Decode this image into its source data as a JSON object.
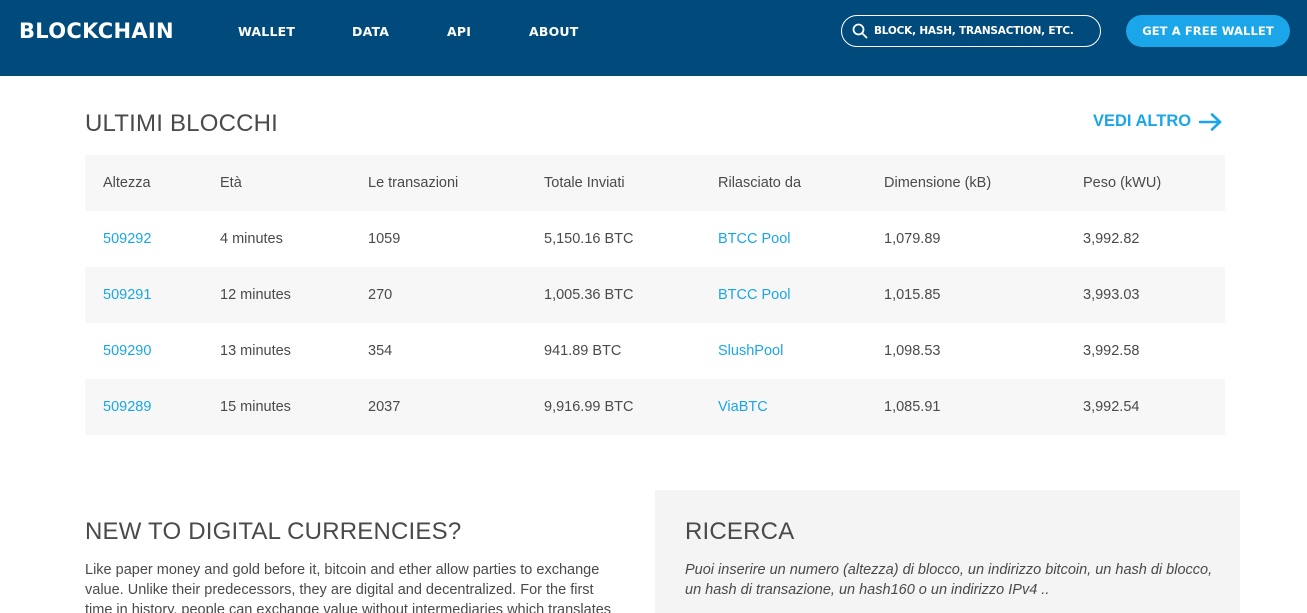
{
  "header": {
    "logo": "BLOCKCHAIN",
    "nav": [
      "WALLET",
      "DATA",
      "API",
      "ABOUT"
    ],
    "search_placeholder": "BLOCK, HASH, TRANSACTION, ETC...",
    "cta_label": "GET A FREE WALLET",
    "colors": {
      "bar": "#004a7c",
      "accent": "#1ba6e9"
    }
  },
  "blocks": {
    "title": "ULTIMI BLOCCHI",
    "see_more": "VEDI ALTRO",
    "columns": [
      "Altezza",
      "Età",
      "Le transazioni",
      "Totale Inviati",
      "Rilasciato da",
      "Dimensione (kB)",
      "Peso (kWU)"
    ],
    "rows": [
      {
        "height": "509292",
        "age": "4 minutes",
        "tx": "1059",
        "sent": "5,150.16 BTC",
        "relayed_by": "BTCC Pool",
        "size": "1,079.89",
        "weight": "3,992.82"
      },
      {
        "height": "509291",
        "age": "12 minutes",
        "tx": "270",
        "sent": "1,005.36 BTC",
        "relayed_by": "BTCC Pool",
        "size": "1,015.85",
        "weight": "3,993.03"
      },
      {
        "height": "509290",
        "age": "13 minutes",
        "tx": "354",
        "sent": "941.89 BTC",
        "relayed_by": "SlushPool",
        "size": "1,098.53",
        "weight": "3,992.58"
      },
      {
        "height": "509289",
        "age": "15 minutes",
        "tx": "2037",
        "sent": "9,916.99 BTC",
        "relayed_by": "ViaBTC",
        "size": "1,085.91",
        "weight": "3,992.54"
      }
    ]
  },
  "intro": {
    "title": "NEW TO DIGITAL CURRENCIES?",
    "text": "Like paper money and gold before it, bitcoin and ether allow parties to exchange value. Unlike their predecessors, they are digital and decentralized. For the first time in history, people can exchange value without intermediaries which translates to"
  },
  "search_panel": {
    "title": "RICERCA",
    "text": "Puoi inserire un numero (altezza) di blocco, un indirizzo bitcoin, un hash di blocco, un hash di transazione, un hash160 o un indirizzo IPv4 .."
  },
  "icons": {
    "search": "search-icon",
    "arrow": "arrow-right-icon"
  }
}
